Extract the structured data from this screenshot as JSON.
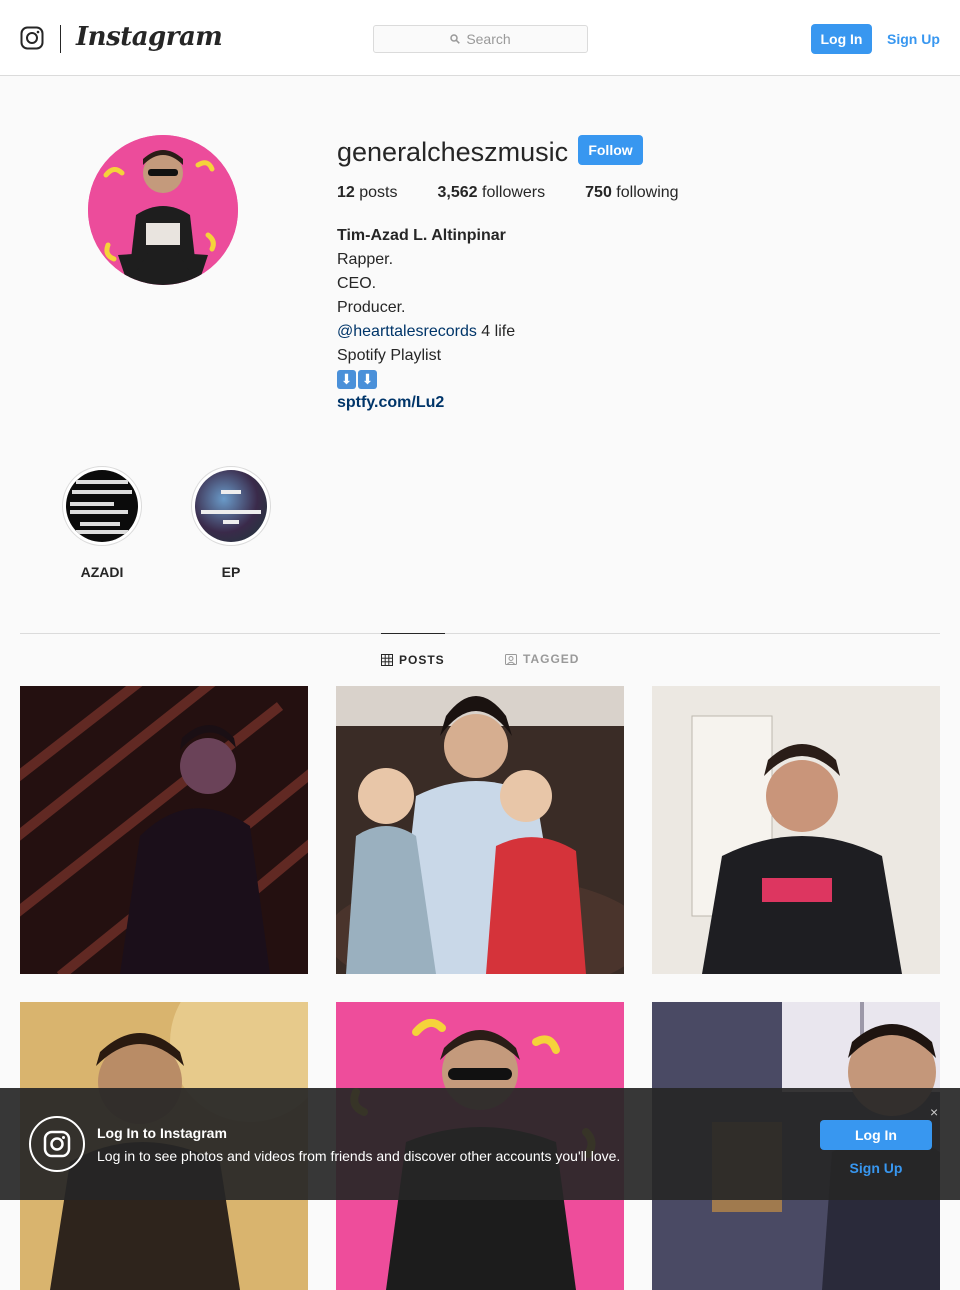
{
  "nav": {
    "wordmark": "Instagram",
    "search_placeholder": "Search",
    "login": "Log In",
    "signup": "Sign Up"
  },
  "profile": {
    "username": "generalcheszmusic",
    "follow": "Follow",
    "stats": {
      "posts_count": "12",
      "posts_label": "posts",
      "followers_count": "3,562",
      "followers_label": "followers",
      "following_count": "750",
      "following_label": "following"
    },
    "bio": {
      "name": "Tim-Azad L. Altinpinar",
      "line1": "Rapper.",
      "line2": "CEO.",
      "line3": "Producer.",
      "mention": "@hearttalesrecords",
      "mention_suffix": " 4 life",
      "line5": "Spotify Playlist",
      "emoji": [
        "⬇",
        "⬇"
      ],
      "link": "sptfy.com/Lu2"
    }
  },
  "highlights": [
    {
      "label": "AZADI"
    },
    {
      "label": "EP"
    }
  ],
  "tabs": [
    {
      "label": "POSTS",
      "icon": "grid-icon"
    },
    {
      "label": "TAGGED",
      "icon": "tagged-icon"
    }
  ],
  "posts": [
    {
      "colors": [
        "#2b1414",
        "#7a2e2a"
      ]
    },
    {
      "colors": [
        "#3a2a24",
        "#c7d6e6"
      ]
    },
    {
      "colors": [
        "#efeae2",
        "#1f1f1f"
      ]
    },
    {
      "colors": [
        "#d8b06a",
        "#3a2a1e"
      ]
    },
    {
      "colors": [
        "#ee4d9b",
        "#1d1d1d"
      ]
    },
    {
      "colors": [
        "#4b4a63",
        "#c29a7a"
      ]
    }
  ],
  "banner": {
    "title": "Log In to Instagram",
    "subtitle": "Log in to see photos and videos from friends and discover other accounts you'll love.",
    "login": "Log In",
    "signup": "Sign Up",
    "close": "×"
  },
  "colors": {
    "accent": "#3897f0",
    "link_dark": "#003569",
    "background": "#fafafa"
  }
}
